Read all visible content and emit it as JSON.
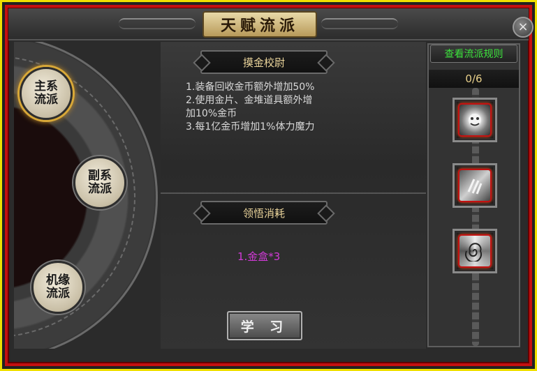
{
  "window": {
    "title": "天赋流派",
    "close_label": "×"
  },
  "schools": [
    {
      "line1": "主系",
      "line2": "流派",
      "active": true
    },
    {
      "line1": "副系",
      "line2": "流派",
      "active": false
    },
    {
      "line1": "机缘",
      "line2": "流派",
      "active": false
    }
  ],
  "talent": {
    "name": "摸金校尉",
    "effects": [
      "1.装备回收金币额外增加50%",
      "2.使用金片、金堆道具额外增",
      "加10%金币",
      "3.每1亿金币增加1%体力魔力"
    ]
  },
  "cost": {
    "header": "领悟消耗",
    "items": [
      "1.金盒*3"
    ]
  },
  "learn_button": "学 习",
  "right_panel": {
    "rules_button": "查看流派规则",
    "counter": "0/6",
    "skills": [
      {
        "icon": "beast-skill-icon"
      },
      {
        "icon": "claw-skill-icon"
      },
      {
        "icon": "vortex-skill-icon"
      }
    ]
  },
  "colors": {
    "outer_border": "#f0e000",
    "frame_red": "#c41010",
    "header_text": "#e9d39a",
    "cost_text": "#d23ad8",
    "rules_text": "#3ce23c"
  }
}
